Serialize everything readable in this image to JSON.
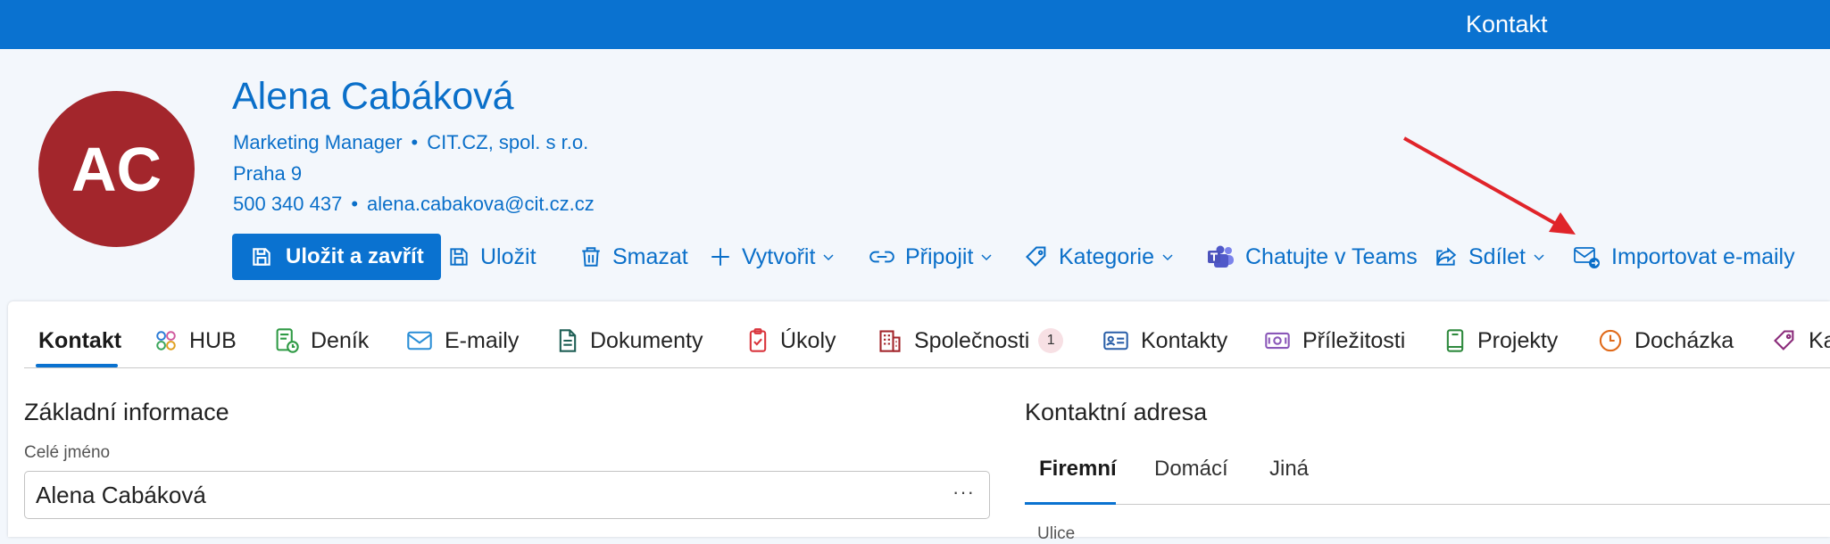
{
  "header": {
    "title": "Kontakt"
  },
  "contact": {
    "initials": "AC",
    "name": "Alena Cabáková",
    "job_title": "Marketing Manager",
    "company": "CIT.CZ, spol. s r.o.",
    "city": "Praha 9",
    "phone": "500 340 437",
    "email": "alena.cabakova@cit.cz.cz",
    "separator": "•"
  },
  "toolbar": {
    "save_close": "Uložit a zavřít",
    "save": "Uložit",
    "delete": "Smazat",
    "create": "Vytvořit",
    "connect": "Připojit",
    "category": "Kategorie",
    "teams": "Chatujte v Teams",
    "share": "Sdílet",
    "import_emails": "Importovat e-maily"
  },
  "tabs": [
    {
      "label": "Kontakt",
      "icon": "none",
      "active": true
    },
    {
      "label": "HUB",
      "icon": "hub-icon"
    },
    {
      "label": "Deník",
      "icon": "journal-icon"
    },
    {
      "label": "E-maily",
      "icon": "mail-icon"
    },
    {
      "label": "Dokumenty",
      "icon": "document-icon"
    },
    {
      "label": "Úkoly",
      "icon": "task-icon"
    },
    {
      "label": "Společnosti",
      "icon": "building-icon",
      "badge": "1"
    },
    {
      "label": "Kontakty",
      "icon": "contact-card-icon"
    },
    {
      "label": "Příležitosti",
      "icon": "money-icon"
    },
    {
      "label": "Projekty",
      "icon": "project-icon"
    },
    {
      "label": "Docházka",
      "icon": "clock-icon"
    },
    {
      "label": "Ka",
      "icon": "tag-icon"
    }
  ],
  "basic_info": {
    "title": "Základní informace",
    "full_name_label": "Celé jméno",
    "full_name_value": "Alena Cabáková",
    "more": "···"
  },
  "address": {
    "title": "Kontaktní adresa",
    "tabs": [
      "Firemní",
      "Domácí",
      "Jiná"
    ],
    "street_label": "Ulice"
  },
  "colors": {
    "brand": "#0a72d0",
    "avatar": "#a3262c",
    "annotation_arrow": "#e0242a"
  }
}
